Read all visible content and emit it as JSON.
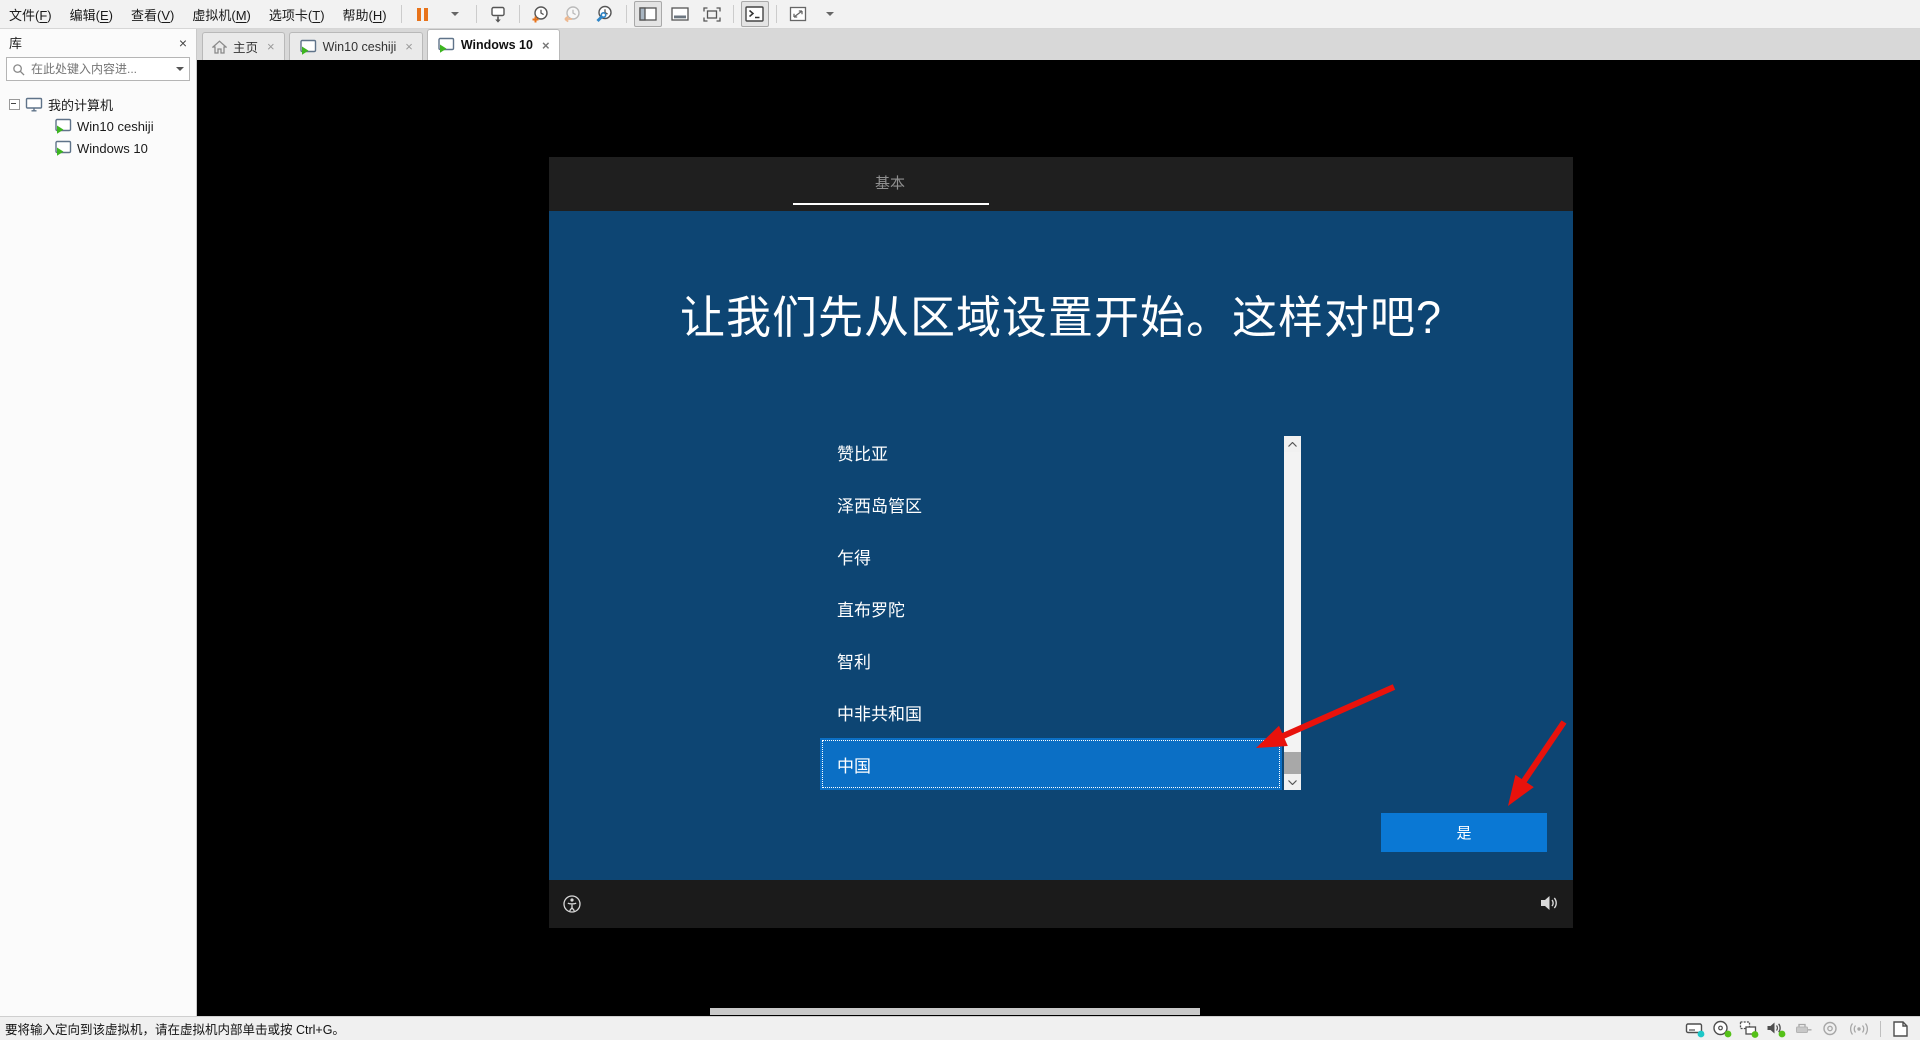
{
  "menubar": {
    "items": [
      {
        "pre": "文件(",
        "mnemonic": "F",
        "post": ")"
      },
      {
        "pre": "编辑(",
        "mnemonic": "E",
        "post": ")"
      },
      {
        "pre": "查看(",
        "mnemonic": "V",
        "post": ")"
      },
      {
        "pre": "虚拟机(",
        "mnemonic": "M",
        "post": ")"
      },
      {
        "pre": "选项卡(",
        "mnemonic": "T",
        "post": ")"
      },
      {
        "pre": "帮助(",
        "mnemonic": "H",
        "post": ")"
      }
    ]
  },
  "toolbar": {
    "icons": [
      "suspend",
      "suspend-dropdown",
      "send-ctrl-alt-del",
      "take-snapshot",
      "revert-snapshot",
      "manage-snapshots",
      "show-library",
      "show-thumbnail-bar",
      "unity-mode",
      "console-view",
      "free-stretch",
      "stretch-dropdown"
    ]
  },
  "tabs": [
    {
      "label": "主页"
    },
    {
      "label": "Win10 ceshiji"
    },
    {
      "label": "Windows 10"
    }
  ],
  "library": {
    "title": "库",
    "search_placeholder": "在此处键入内容进...",
    "tree": {
      "computer": "我的计算机",
      "vms": [
        "Win10 ceshiji",
        "Windows 10"
      ]
    }
  },
  "oobe": {
    "section": "基本",
    "title": "让我们先从区域设置开始。这样对吧?",
    "regions": [
      "赞比亚",
      "泽西岛管区",
      "乍得",
      "直布罗陀",
      "智利",
      "中非共和国",
      "中国"
    ],
    "selected_region": "中国",
    "yes_label": "是"
  },
  "statusbar": {
    "message": "要将输入定向到该虚拟机，请在虚拟机内部单击或按 Ctrl+G。",
    "icons": [
      "hard-disk",
      "cd-dvd",
      "network",
      "sound",
      "usb",
      "webcam",
      "wifi",
      "message-log"
    ]
  },
  "colors": {
    "oobe_background": "#0d4573",
    "selected_row": "#0b6fc5",
    "yes_button": "#0a78d4",
    "oobe_header": "#1f1f1f",
    "suspend_orange": "#e8731a",
    "annotation_red": "#e8120c",
    "status_green": "#55c119",
    "status_teal": "#1ec8c8"
  }
}
